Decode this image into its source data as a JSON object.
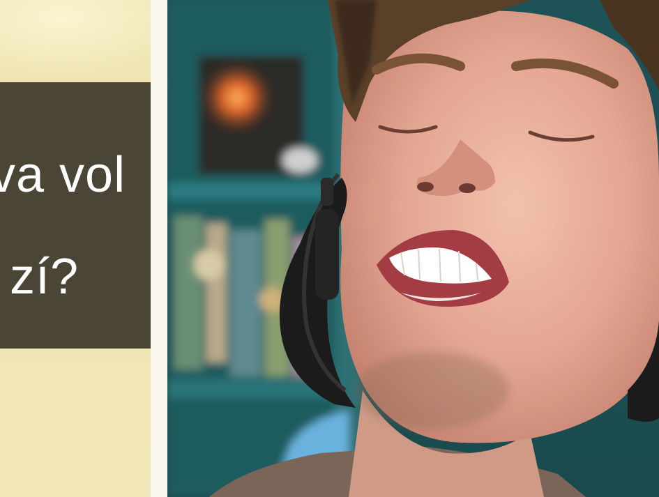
{
  "game_panel": {
    "question_line_1": "va vol",
    "question_line_2": "zí?"
  },
  "colors": {
    "panel_background": "#f0e7b6",
    "question_box": "#4a4535",
    "question_text": "#ffffff",
    "divider": "#fbf8ef",
    "shelf_teal": "#1f5a5e"
  },
  "video": {
    "description_icons": [
      "webcam-feed",
      "headset-icon"
    ]
  }
}
